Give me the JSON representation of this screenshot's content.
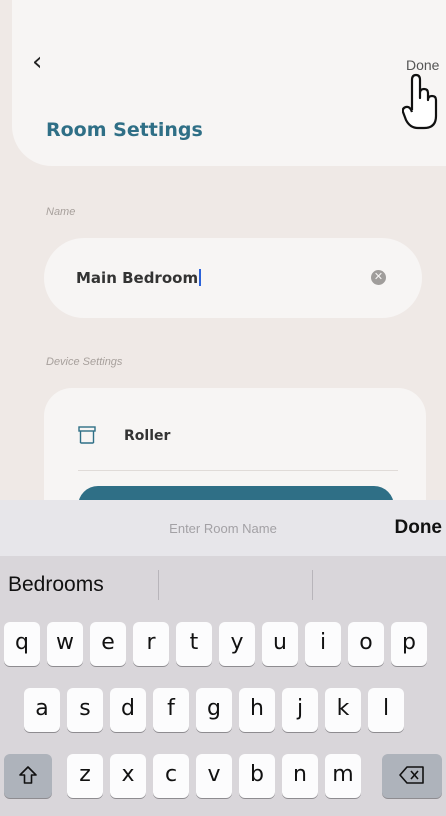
{
  "header": {
    "back_icon": "chevron-left-icon",
    "done_label": "Done",
    "title": "Room Settings"
  },
  "name_section": {
    "label": "Name",
    "value": "Main Bedroom",
    "clear_icon": "clear-x-icon"
  },
  "device_section": {
    "label": "Device Settings",
    "device_icon": "roller-blind-icon",
    "device_label": "Roller"
  },
  "toolbar": {
    "placeholder": "Enter Room Name",
    "done_label": "Done"
  },
  "keyboard": {
    "suggestion": "Bedrooms",
    "row1": [
      "q",
      "w",
      "e",
      "r",
      "t",
      "y",
      "u",
      "i",
      "o",
      "p"
    ],
    "row2": [
      "a",
      "s",
      "d",
      "f",
      "g",
      "h",
      "j",
      "k",
      "l"
    ],
    "row3": [
      "z",
      "x",
      "c",
      "v",
      "b",
      "n",
      "m"
    ],
    "shift_icon": "shift-icon",
    "delete_icon": "backspace-icon"
  },
  "colors": {
    "accent": "#2f6f86",
    "background": "#efe9e6",
    "card": "#f7f5f4",
    "keyboard": "#d9d6da"
  }
}
